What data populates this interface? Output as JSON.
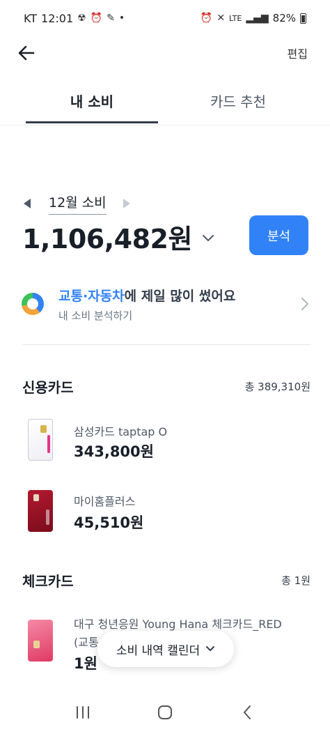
{
  "status_bar": {
    "carrier": "KT",
    "time": "12:01",
    "network": "LTE",
    "battery": "82%"
  },
  "header": {
    "edit_label": "편집"
  },
  "tabs": [
    {
      "label": "내 소비",
      "active": true
    },
    {
      "label": "카드 추천",
      "active": false
    }
  ],
  "spending": {
    "month_label": "12월 소비",
    "total_amount": "1,106,482원",
    "analyze_label": "분석"
  },
  "insight": {
    "category": "교통·자동차",
    "title_suffix": "에 제일 많이 썼어요",
    "subtitle": "내 소비 분석하기"
  },
  "credit_section": {
    "title": "신용카드",
    "total": "총 389,310원",
    "cards": [
      {
        "name": "삼성카드 taptap O",
        "amount": "343,800원"
      },
      {
        "name": "마이홈플러스",
        "amount": "45,510원"
      }
    ]
  },
  "check_section": {
    "title": "체크카드",
    "total": "총 1원",
    "cards": [
      {
        "name": "대구 청년응원 Young Hana 체크카드_RED",
        "name_line2": "(교통",
        "amount": "1원"
      }
    ]
  },
  "floating_button": {
    "label": "소비 내역 캘린더"
  },
  "colors": {
    "accent": "#3182f6",
    "text_primary": "#191f28",
    "text_secondary": "#6b7684"
  }
}
